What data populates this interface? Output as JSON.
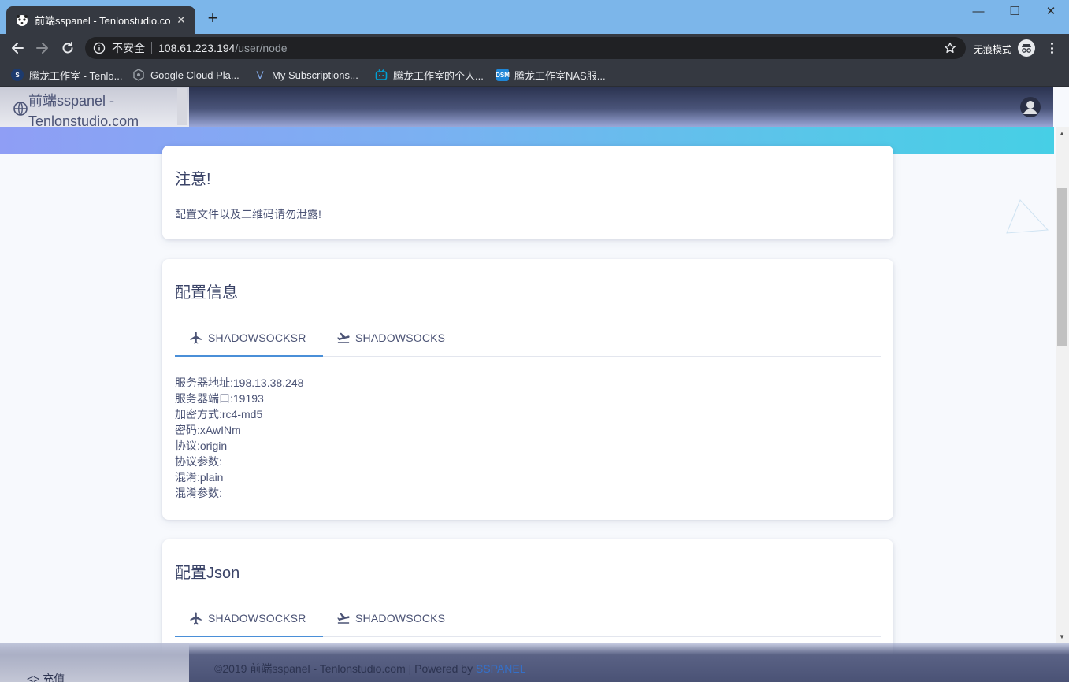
{
  "browser": {
    "tab_title": "前端sspanel - Tenlonstudio.com",
    "tab_close": "✕",
    "new_tab": "+",
    "window_min": "—",
    "window_max": "☐",
    "window_close": "✕",
    "security_label": "不安全",
    "url_host": "108.61.223.194",
    "url_path": "/user/node",
    "incognito_label": "无痕模式",
    "bookmarks": [
      {
        "label": "腾龙工作室 - Tenlo...",
        "icon": "tenlon-icon"
      },
      {
        "label": "Google Cloud Pla...",
        "icon": "gcp-icon"
      },
      {
        "label": "My Subscriptions...",
        "icon": "v-icon"
      },
      {
        "label": "腾龙工作室的个人...",
        "icon": "bilibili-icon"
      },
      {
        "label": "腾龙工作室NAS服...",
        "icon": "dsm-icon"
      }
    ]
  },
  "sidebar": {
    "brand": "前端sspanel - Tenlonstudio.com",
    "recharge_label": "充值",
    "recharge_icon": "<>"
  },
  "notice": {
    "title": "注意!",
    "text": "配置文件以及二维码请勿泄露!"
  },
  "config_info": {
    "title": "配置信息",
    "tabs": [
      {
        "label": "SHADOWSOCKSR",
        "icon": "flight-icon",
        "active": true
      },
      {
        "label": "SHADOWSOCKS",
        "icon": "flight-takeoff-icon",
        "active": false
      }
    ],
    "lines": [
      "服务器地址:198.13.38.248",
      "服务器端口:19193",
      "加密方式:rc4-md5",
      "密码:xAwINm",
      "协议:origin",
      "协议参数:",
      "混淆:plain",
      "混淆参数:"
    ]
  },
  "config_json": {
    "title": "配置Json",
    "tabs": [
      {
        "label": "SHADOWSOCKSR",
        "icon": "flight-icon",
        "active": true
      },
      {
        "label": "SHADOWSOCKS",
        "icon": "flight-takeoff-icon",
        "active": false
      }
    ]
  },
  "footer": {
    "text": "©2019 前端sspanel - Tenlonstudio.com | Powered by ",
    "link": "SSPANEL"
  },
  "colors": {
    "chrome_titlebar": "#7cb6ea",
    "chrome_toolbar": "#353941",
    "accent": "#4a8fd8",
    "text": "#4b5375"
  }
}
